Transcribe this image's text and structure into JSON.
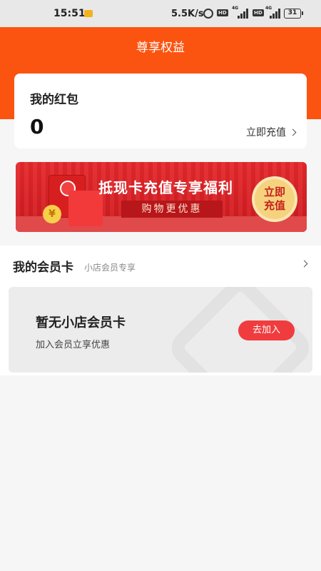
{
  "status_bar": {
    "time": "15:51",
    "speed": "5.5K/s",
    "network_hd": "HD",
    "network_4g": "4G",
    "battery": "31"
  },
  "header": {
    "title": "尊享权益"
  },
  "red_packet": {
    "title": "我的红包",
    "value": "0",
    "recharge_label": "立即充值"
  },
  "banner": {
    "headline": "抵现卡充值专享福利",
    "subtitle": "购物更优惠",
    "button_line1": "立即",
    "button_line2": "充值",
    "coin_symbol": "¥"
  },
  "member": {
    "title": "我的会员卡",
    "subtitle": "小店会员专享",
    "card_title": "暂无小店会员卡",
    "card_subtitle": "加入会员立享优惠",
    "join_label": "去加入"
  },
  "colors": {
    "brand_orange": "#fb5410",
    "join_red": "#f03c3e",
    "banner_red": "#e4282b"
  }
}
